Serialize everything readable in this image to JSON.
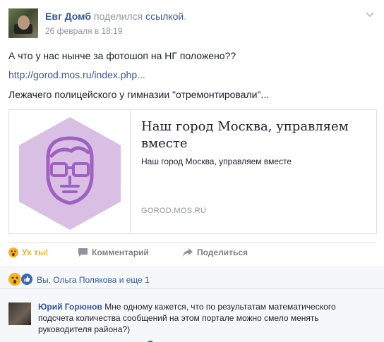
{
  "header": {
    "author": "Евг Домб",
    "action": "поделился",
    "action_link": "ссылкой",
    "action_end": ".",
    "date": "26 февраля в 18:19"
  },
  "post": {
    "line1": "А что у нас нынче за фотошоп на НГ положено??",
    "link": "http://gorod.mos.ru/index.php...",
    "line3": "Лежачего полицейского у гимназии \"отремонтировали\"..."
  },
  "card": {
    "title": "Наш город Москва, управляем вместе",
    "description": "Наш город Москва, управляем вместе",
    "domain": "GOROD.MOS.RU",
    "hex_color": "#d9bfe4",
    "icon_color": "#a060c0"
  },
  "actions": {
    "wow": "Ух ты!",
    "comment": "Комментарий",
    "share": "Поделиться"
  },
  "reactions": {
    "text": "Вы, Ольга Полякова и еще 1"
  },
  "comment": {
    "author": "Юрий Горюнов",
    "text": "Мне одному кажется, что по результатам математического подсчета количества сообщений на этом портале можно смело менять руководителя района?)"
  },
  "colors": {
    "link_blue": "#365899",
    "muted": "#90949c",
    "wow_yellow": "#e9b130"
  }
}
